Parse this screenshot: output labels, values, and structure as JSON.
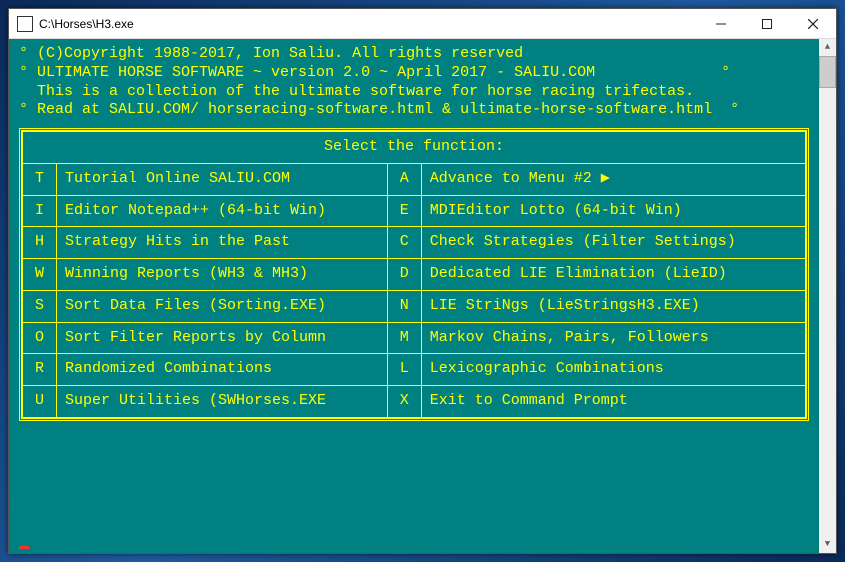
{
  "window": {
    "title": "C:\\Horses\\H3.exe"
  },
  "header": {
    "line1_pre": "° ",
    "line1": "(C)Copyright 1988-2017, Ion Saliu. All rights reserved",
    "line2_pre": "° ",
    "line2": "ULTIMATE HORSE SOFTWARE ~ version 2.0 ~ April 2017 - SALIU.COM",
    "line2_post": "              °",
    "line3": "  This is a collection of the ultimate software for horse racing trifectas.",
    "line4_pre": "° ",
    "line4": "Read at SALIU.COM/ horseracing-software.html & ultimate-horse-software.html",
    "line4_post": "  °"
  },
  "menu": {
    "title": "Select the function:",
    "left": [
      {
        "key": "T",
        "label": "Tutorial Online SALIU.COM"
      },
      {
        "key": "I",
        "label": "Editor Notepad++ (64-bit Win)"
      },
      {
        "key": "H",
        "label": "Strategy Hits in the Past"
      },
      {
        "key": "W",
        "label": "Winning Reports (WH3 & MH3)"
      },
      {
        "key": "S",
        "label": "Sort Data Files (Sorting.EXE)"
      },
      {
        "key": "O",
        "label": "Sort Filter Reports by Column"
      },
      {
        "key": "R",
        "label": "Randomized Combinations"
      },
      {
        "key": "U",
        "label": "Super Utilities (SWHorses.EXE"
      }
    ],
    "right": [
      {
        "key": "A",
        "label": "Advance to Menu #2 ▶"
      },
      {
        "key": "E",
        "label": "MDIEditor Lotto (64-bit Win)"
      },
      {
        "key": "C",
        "label": "Check Strategies (Filter Settings)"
      },
      {
        "key": "D",
        "label": "Dedicated LIE Elimination (LieID)"
      },
      {
        "key": "N",
        "label": "LIE StriNgs (LieStringsH3.EXE)"
      },
      {
        "key": "M",
        "label": "Markov Chains, Pairs, Followers"
      },
      {
        "key": "L",
        "label": "Lexicographic Combinations"
      },
      {
        "key": "X",
        "label": "Exit to Command Prompt"
      }
    ]
  }
}
